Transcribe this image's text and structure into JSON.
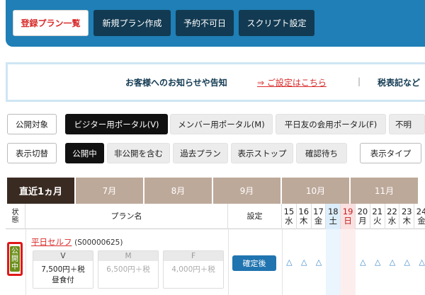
{
  "nav": {
    "tabs": [
      {
        "label": "登録プラン一覧",
        "active": true
      },
      {
        "label": "新規プラン作成",
        "active": false
      },
      {
        "label": "予約不可日",
        "active": false
      },
      {
        "label": "スクリプト設定",
        "active": false
      }
    ]
  },
  "notice": {
    "text": "お客様へのお知らせや告知",
    "link": "⇒ ご設定はこちら",
    "separator": "|",
    "text2": "税表記など"
  },
  "filters": {
    "target_label": "公開対象",
    "targets": [
      "ビジター用ポータル(V)",
      "メンバー用ポータル(M)",
      "平日友の会用ポータル(F)",
      "不明"
    ],
    "switch_label": "表示切替",
    "switches": [
      "公開中",
      "非公開を含む",
      "過去プラン",
      "表示ストップ",
      "確認待ち"
    ],
    "display_type": "表示タイプ"
  },
  "table": {
    "months": [
      "直近1ヵ月",
      "7月",
      "8月",
      "9月",
      "10月",
      "11月"
    ],
    "headers": {
      "status": "状態",
      "plan_name": "プラン名",
      "settings": "設定"
    },
    "days": [
      {
        "num": "15",
        "dow": "水"
      },
      {
        "num": "16",
        "dow": "木"
      },
      {
        "num": "17",
        "dow": "金"
      },
      {
        "num": "18",
        "dow": "土"
      },
      {
        "num": "19",
        "dow": "日"
      },
      {
        "num": "20",
        "dow": "月"
      },
      {
        "num": "21",
        "dow": "火"
      },
      {
        "num": "22",
        "dow": "水"
      },
      {
        "num": "23",
        "dow": "木"
      },
      {
        "num": "24",
        "dow": "金"
      }
    ],
    "row": {
      "status": "公開中",
      "plan_name": "平日セルフ",
      "plan_id": "(S00000625)",
      "prices": [
        {
          "key": "V",
          "value": "7,500円＋税",
          "sub": "昼食付"
        },
        {
          "key": "M",
          "value": "6,500円＋税",
          "sub": ""
        },
        {
          "key": "F",
          "value": "4,000円＋税",
          "sub": ""
        }
      ],
      "settings_button": "確定後",
      "availability": [
        "△",
        "△",
        "△",
        "",
        "",
        "△",
        "△",
        "△",
        "△",
        "△"
      ]
    }
  },
  "colors": {
    "nav_bg": "#1f7fb6",
    "accent_red": "#d92b2b",
    "status_green": "#6b8e1a"
  }
}
